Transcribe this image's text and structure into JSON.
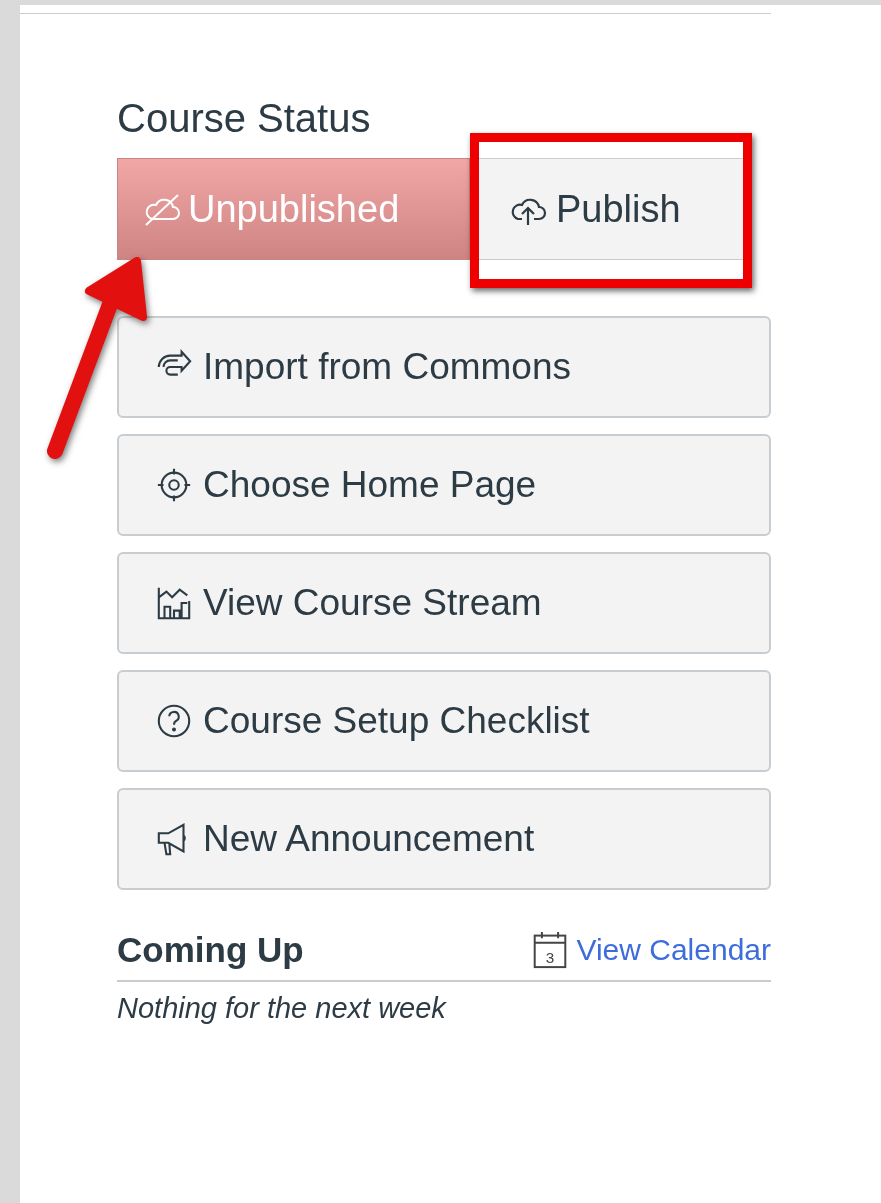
{
  "course_status": {
    "heading": "Course Status",
    "published": false,
    "unpublished_label": "Unpublished",
    "publish_label": "Publish"
  },
  "actions": [
    {
      "kind": "import",
      "label": "Import from Commons"
    },
    {
      "kind": "home",
      "label": "Choose Home Page"
    },
    {
      "kind": "stream",
      "label": "View Course Stream"
    },
    {
      "kind": "checklist",
      "label": "Course Setup Checklist"
    },
    {
      "kind": "announcement",
      "label": "New Announcement"
    }
  ],
  "coming_up": {
    "heading": "Coming Up",
    "calendar_day": "3",
    "link": "View Calendar",
    "empty_text": "Nothing for the next week"
  },
  "annotations": {
    "highlight_publish": true,
    "arrow_to_status": true
  }
}
